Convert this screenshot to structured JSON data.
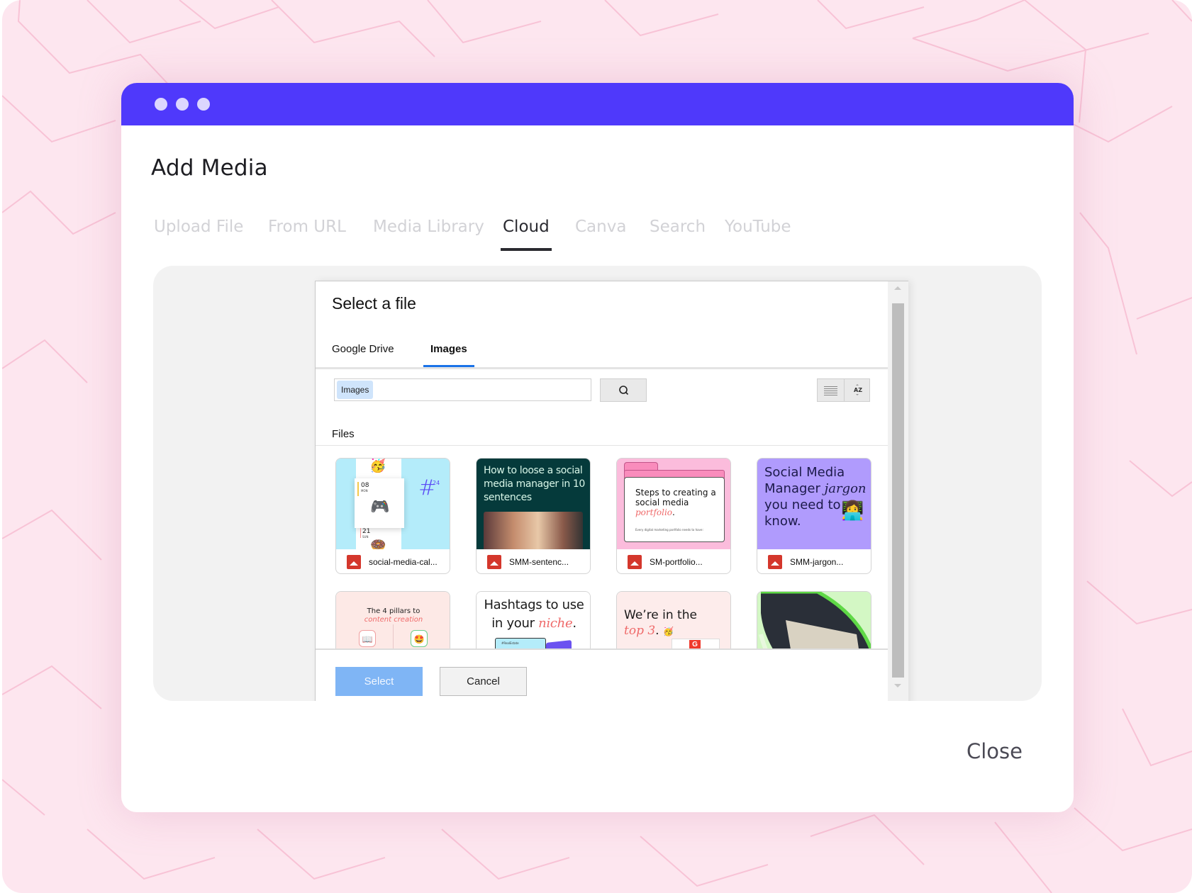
{
  "window": {
    "header_color": "#4f39fb",
    "dots": [
      "dot",
      "dot",
      "dot"
    ]
  },
  "modal": {
    "title": "Add Media",
    "tabs": [
      {
        "label": "Upload File",
        "active": false
      },
      {
        "label": "From URL",
        "active": false
      },
      {
        "label": "Media Library",
        "active": false
      },
      {
        "label": "Cloud",
        "active": true
      },
      {
        "label": "Canva",
        "active": false
      },
      {
        "label": "Search",
        "active": false
      },
      {
        "label": "YouTube",
        "active": false
      }
    ],
    "close_label": "Close"
  },
  "picker": {
    "title": "Select a file",
    "tabs": [
      {
        "label": "Google Drive",
        "active": false
      },
      {
        "label": "Images",
        "active": true
      }
    ],
    "search": {
      "chip": "Images",
      "value": "",
      "search_icon": "search-icon"
    },
    "view_buttons": [
      "list-view-icon",
      "sort-az-icon"
    ],
    "files_label": "Files",
    "files": [
      {
        "name": "social-media-cal...",
        "thumb_text": [
          "08",
          "MON",
          "21",
          "SUN",
          "#",
          "24"
        ]
      },
      {
        "name": "SMM-sentenc...",
        "thumb_text": [
          "How to loose a social media manager in 10 sentences"
        ]
      },
      {
        "name": "SM-portfolio...",
        "thumb_text": [
          "Steps to creating a social media",
          "portfolio",
          "Every digital marketing portfolio needs to have:"
        ]
      },
      {
        "name": "SMM-jargon...",
        "thumb_text": [
          "Social Media Manager",
          "jargon",
          "you need to know."
        ]
      },
      {
        "name": "",
        "thumb_text": [
          "The 4 pillars to",
          "content creation"
        ]
      },
      {
        "name": "",
        "thumb_text": [
          "Hashtags to use in your",
          "niche",
          "#RealEstate"
        ]
      },
      {
        "name": "",
        "thumb_text": [
          "We’re in the",
          "top 3"
        ]
      },
      {
        "name": "",
        "thumb_text": []
      }
    ],
    "select_label": "Select",
    "cancel_label": "Cancel"
  }
}
